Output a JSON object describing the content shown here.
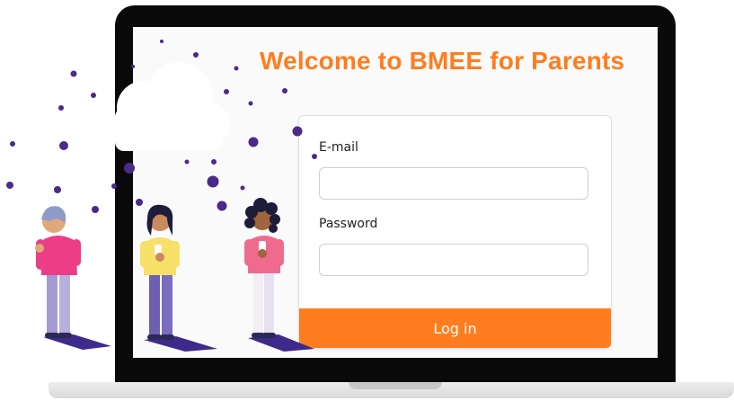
{
  "title": "Welcome to BMEE for Parents",
  "login_form": {
    "email_label": "E-mail",
    "email_value": "",
    "password_label": "Password",
    "password_value": "",
    "submit_label": "Log in"
  },
  "colors": {
    "accent": "#ff7d1e",
    "dots": "#4a2a8a",
    "bezel": "#0a0a0a"
  },
  "illustration": {
    "icons": [
      "cloud-icon",
      "person-icon",
      "person-icon",
      "person-icon",
      "phone-icon"
    ]
  }
}
